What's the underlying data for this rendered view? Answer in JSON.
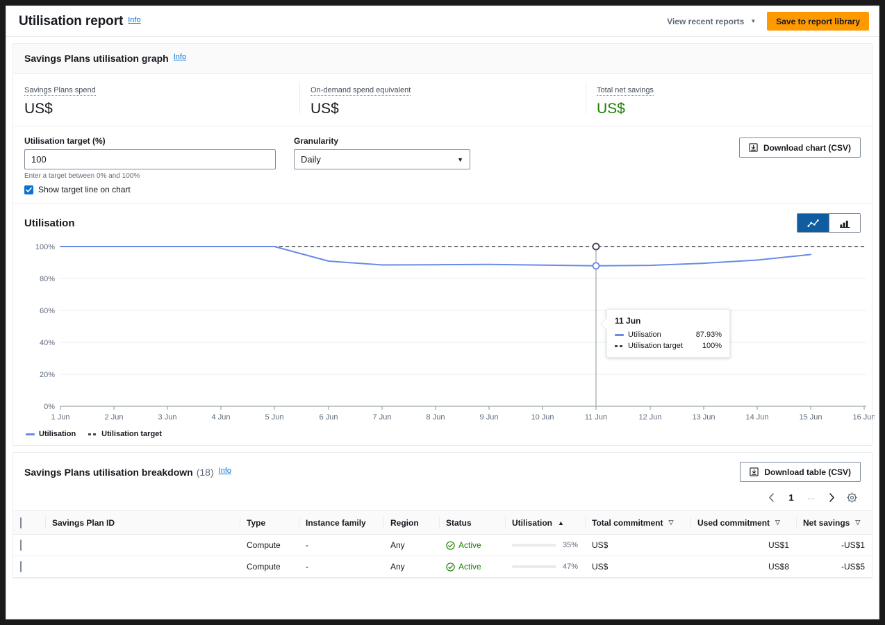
{
  "header": {
    "title": "Utilisation report",
    "info_label": "Info",
    "recent_reports_label": "View recent reports",
    "save_label": "Save to report library"
  },
  "graph_section": {
    "title": "Savings Plans utilisation graph",
    "info_label": "Info"
  },
  "kpis": [
    {
      "label": "Savings Plans spend",
      "value": "US$",
      "color": "#16191f"
    },
    {
      "label": "On-demand spend equivalent",
      "value": "US$",
      "color": "#16191f"
    },
    {
      "label": "Total net savings",
      "value": "US$",
      "color": "#1d8102"
    }
  ],
  "controls": {
    "target_label": "Utilisation target (%)",
    "target_value": "100",
    "target_hint": "Enter a target between 0% and 100%",
    "show_target_label": "Show target line on chart",
    "show_target_checked": true,
    "granularity_label": "Granularity",
    "granularity_value": "Daily",
    "download_chart_label": "Download chart (CSV)"
  },
  "chart": {
    "title": "Utilisation",
    "view_line_icon": "line-chart-icon",
    "view_bar_icon": "bar-chart-icon",
    "legend": [
      {
        "name": "Utilisation",
        "style": "solid",
        "color": "#688ae8"
      },
      {
        "name": "Utilisation target",
        "style": "dotted",
        "color": "#424650"
      }
    ],
    "tooltip": {
      "title": "11 Jun",
      "rows": [
        {
          "key": "Utilisation",
          "value": "87.93%",
          "style": "solid"
        },
        {
          "key": "Utilisation target",
          "value": "100%",
          "style": "dotted"
        }
      ]
    }
  },
  "chart_data": {
    "type": "line",
    "title": "Utilisation",
    "xlabel": "",
    "ylabel": "",
    "ylim": [
      0,
      100
    ],
    "yticks": [
      "0%",
      "20%",
      "40%",
      "60%",
      "80%",
      "100%"
    ],
    "ytick_values": [
      0,
      20,
      40,
      60,
      80,
      100
    ],
    "grid": true,
    "legend_position": "bottom-left",
    "x": [
      "1 Jun",
      "2 Jun",
      "3 Jun",
      "4 Jun",
      "5 Jun",
      "6 Jun",
      "7 Jun",
      "8 Jun",
      "9 Jun",
      "10 Jun",
      "11 Jun",
      "12 Jun",
      "13 Jun",
      "14 Jun",
      "15 Jun",
      "16 Jun"
    ],
    "series": [
      {
        "name": "Utilisation",
        "style": "solid",
        "color": "#688ae8",
        "values": [
          100,
          100,
          100,
          100,
          100,
          91,
          88.5,
          88.6,
          88.8,
          88.4,
          87.93,
          88.2,
          89.5,
          91.5,
          95,
          null
        ]
      },
      {
        "name": "Utilisation target",
        "style": "dashed",
        "color": "#424650",
        "values": [
          100,
          100,
          100,
          100,
          100,
          100,
          100,
          100,
          100,
          100,
          100,
          100,
          100,
          100,
          100,
          100
        ]
      }
    ],
    "highlight": {
      "x": "11 Jun",
      "utilisation": 87.93,
      "target": 100
    }
  },
  "breakdown": {
    "title": "Savings Plans utilisation breakdown",
    "count": "(18)",
    "info_label": "Info",
    "download_table_label": "Download table (CSV)",
    "pagination": {
      "prev_icon": "chevron-left-icon",
      "page": "1",
      "ellipsis": "…",
      "next_icon": "chevron-right-icon",
      "settings_icon": "gear-icon"
    },
    "columns": [
      {
        "label": "Savings Plan ID",
        "sort": "none"
      },
      {
        "label": "Type",
        "sort": "none"
      },
      {
        "label": "Instance family",
        "sort": "none"
      },
      {
        "label": "Region",
        "sort": "none"
      },
      {
        "label": "Status",
        "sort": "none"
      },
      {
        "label": "Utilisation",
        "sort": "asc"
      },
      {
        "label": "Total commitment",
        "sort": "desc-inactive"
      },
      {
        "label": "Used commitment",
        "sort": "desc-inactive"
      },
      {
        "label": "Net savings",
        "sort": "desc-inactive"
      }
    ],
    "rows": [
      {
        "plan_id": "",
        "type": "Compute",
        "instance_family": "-",
        "region": "Any",
        "status": "Active",
        "utilisation_pct": "35%",
        "utilisation_value": 35,
        "total_commitment": "US$",
        "used_commitment": "US$1",
        "net_savings": "-US$1"
      },
      {
        "plan_id": "",
        "type": "Compute",
        "instance_family": "-",
        "region": "Any",
        "status": "Active",
        "utilisation_pct": "47%",
        "utilisation_value": 47,
        "total_commitment": "US$",
        "used_commitment": "US$8",
        "net_savings": "-US$5"
      }
    ]
  },
  "colors": {
    "accent": "#0972d3",
    "brand_orange": "#ff9900",
    "success_green": "#1d8102",
    "line_blue": "#688ae8"
  }
}
